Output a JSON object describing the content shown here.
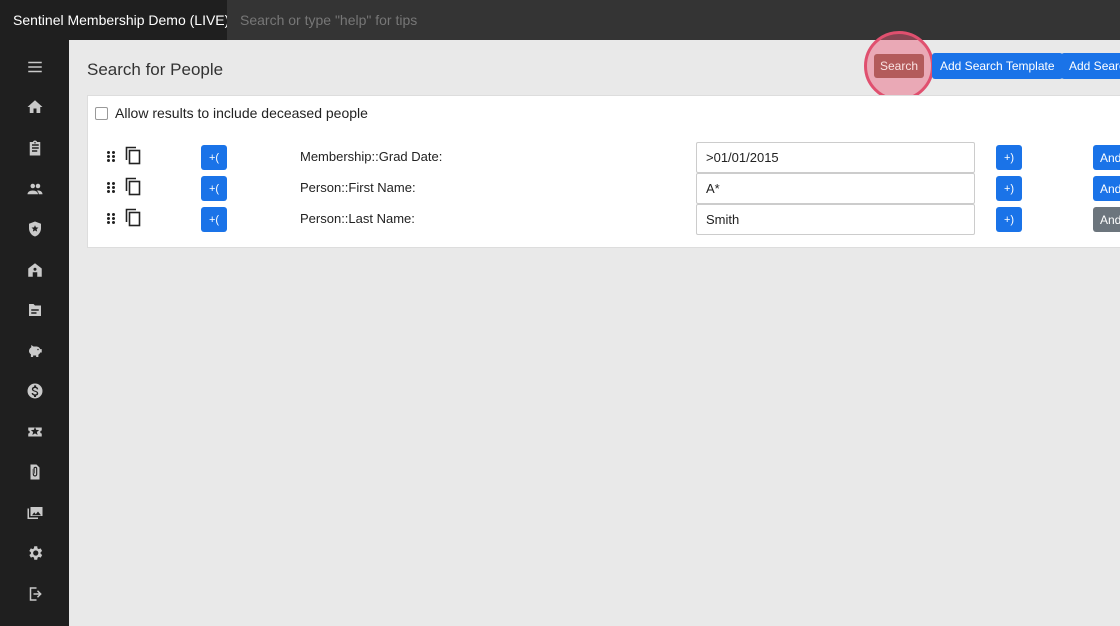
{
  "app": {
    "title": "Sentinel Membership Demo (LIVE)"
  },
  "topbar": {
    "search_placeholder": "Search or type \"help\" for tips"
  },
  "sidebar": {
    "items": [
      {
        "icon": "menu-icon"
      },
      {
        "icon": "home-icon"
      },
      {
        "icon": "clipboard-icon"
      },
      {
        "icon": "people-icon"
      },
      {
        "icon": "shield-icon"
      },
      {
        "icon": "building-icon"
      },
      {
        "icon": "folder-icon"
      },
      {
        "icon": "piggy-bank-icon"
      },
      {
        "icon": "dollar-icon"
      },
      {
        "icon": "ticket-icon"
      },
      {
        "icon": "attachment-icon"
      },
      {
        "icon": "photo-library-icon"
      },
      {
        "icon": "gear-icon"
      },
      {
        "icon": "logout-icon"
      }
    ]
  },
  "main": {
    "title": "Search for People",
    "buttons": {
      "search": "Search",
      "add_template": "Add Search Template",
      "add_search": "Add Search"
    },
    "options": {
      "include_deceased_label": "Allow results to include deceased people",
      "include_deceased_checked": false
    },
    "criteria": [
      {
        "open_paren": "+(",
        "label": "Membership::Grad Date:",
        "value": ">01/01/2015",
        "close_paren": "+)",
        "conjunction": "And",
        "conjunction_color": "#1a73e8"
      },
      {
        "open_paren": "+(",
        "label": "Person::First Name:",
        "value": "A*",
        "close_paren": "+)",
        "conjunction": "And",
        "conjunction_color": "#1a73e8"
      },
      {
        "open_paren": "+(",
        "label": "Person::Last Name:",
        "value": "Smith",
        "close_paren": "+)",
        "conjunction": "And",
        "conjunction_color": "#6c757d"
      }
    ]
  },
  "colors": {
    "accent": "#1a73e8",
    "highlight": "#e0506f",
    "sidebar": "#1f1f1f"
  }
}
